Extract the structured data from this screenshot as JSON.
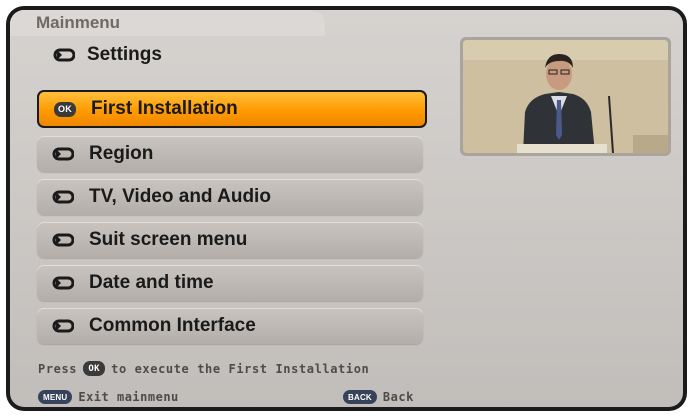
{
  "header": {
    "title": "Mainmenu",
    "subtitle": "Settings"
  },
  "menu": {
    "items": [
      {
        "label": "First Installation",
        "icon": "ok-icon",
        "selected": true
      },
      {
        "label": "Region",
        "icon": "arrow-icon",
        "selected": false
      },
      {
        "label": "TV, Video and Audio",
        "icon": "arrow-icon",
        "selected": false
      },
      {
        "label": "Suit screen menu",
        "icon": "arrow-icon",
        "selected": false
      },
      {
        "label": "Date and time",
        "icon": "arrow-icon",
        "selected": false
      },
      {
        "label": "Common Interface",
        "icon": "arrow-icon",
        "selected": false
      }
    ]
  },
  "help": {
    "prefix": "Press",
    "ok_key": "OK",
    "suffix": "to execute the First Installation"
  },
  "footer": {
    "menu_key": "MENU",
    "exit_label": "Exit mainmenu",
    "back_key": "BACK",
    "back_label": "Back"
  },
  "colors": {
    "selected_accent": "#ff9b00",
    "panel_background": "#cbc7c4",
    "text": "#1a1a1a"
  }
}
